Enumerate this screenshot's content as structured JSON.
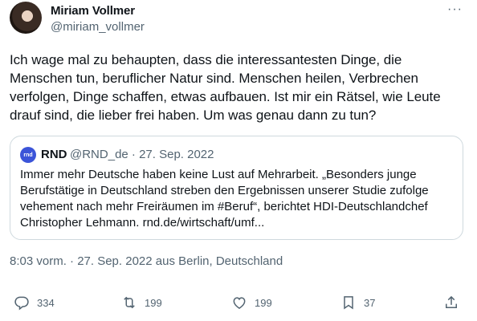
{
  "author": {
    "name": "Miriam Vollmer",
    "handle": "@miriam_vollmer",
    "more_label": "···"
  },
  "tweet": {
    "text": "Ich wage mal zu behaupten, dass die interessantesten Dinge, die Menschen tun, beruflicher Natur sind. Menschen heilen, Verbrechen verfolgen, Dinge schaffen, etwas aufbauen. Ist mir ein Rätsel, wie Leute drauf sind, die lieber frei haben. Um was genau dann zu tun?"
  },
  "quoted": {
    "logo_text": "rnd",
    "name": "RND",
    "handle_date": "@RND_de · 27. Sep. 2022",
    "text": "Immer mehr Deutsche haben keine Lust auf Mehrarbeit. „Besonders junge Berufstätige in Deutschland streben den Ergebnissen unserer Studie zufolge vehement nach mehr Freiräumen im #Beruf“, berichtet HDI-Deutschlandchef Christopher Lehmann. rnd.de/wirtschaft/umf..."
  },
  "meta": {
    "time": "8:03 vorm. · 27. Sep. 2022",
    "location_prefix": " aus ",
    "location": "Berlin, Deutschland"
  },
  "actions": {
    "replies": "334",
    "retweets": "199",
    "likes": "199",
    "bookmarks": "37"
  },
  "icons": [
    "reply-icon",
    "retweet-icon",
    "like-icon",
    "bookmark-icon",
    "share-icon"
  ],
  "colors": {
    "text": "#0f1419",
    "secondary": "#536471",
    "border": "#cfd9de",
    "rnd_blue": "#3b54d8"
  }
}
